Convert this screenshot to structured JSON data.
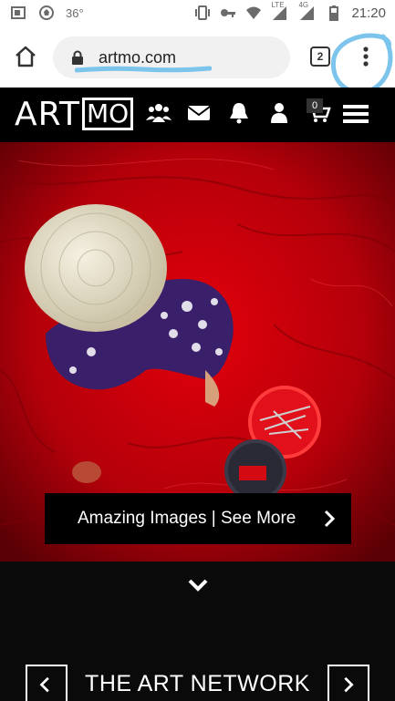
{
  "status_bar": {
    "temperature": "36°",
    "network_label": "LTE",
    "network_gen": "4G",
    "time": "21:20",
    "icons": [
      "sim-icon",
      "soccer-ball-icon",
      "vibrate-icon",
      "key-icon",
      "wifi-icon",
      "signal-icon",
      "battery-icon"
    ]
  },
  "browser": {
    "url": "artmo.com",
    "tab_count": "2",
    "icons": [
      "home-icon",
      "lock-icon",
      "more-vert-icon"
    ]
  },
  "site_nav": {
    "logo_art": "ART",
    "logo_mo": "MO",
    "cart_count": "0",
    "icons": [
      "users-icon",
      "envelope-icon",
      "bell-icon",
      "user-icon",
      "cart-icon",
      "hamburger-icon"
    ]
  },
  "hero": {
    "cta_label": "Amazing Images | See More",
    "colors": {
      "net_red": "#c0000a",
      "hat": "#e9e3cf"
    }
  },
  "bottom": {
    "section_title": "THE ART NETWORK",
    "icons": [
      "chevron-down-icon",
      "chevron-left-icon",
      "chevron-right-icon"
    ]
  },
  "colors": {
    "annotation_blue": "#7cc4ec",
    "nav_bg": "#000000"
  }
}
